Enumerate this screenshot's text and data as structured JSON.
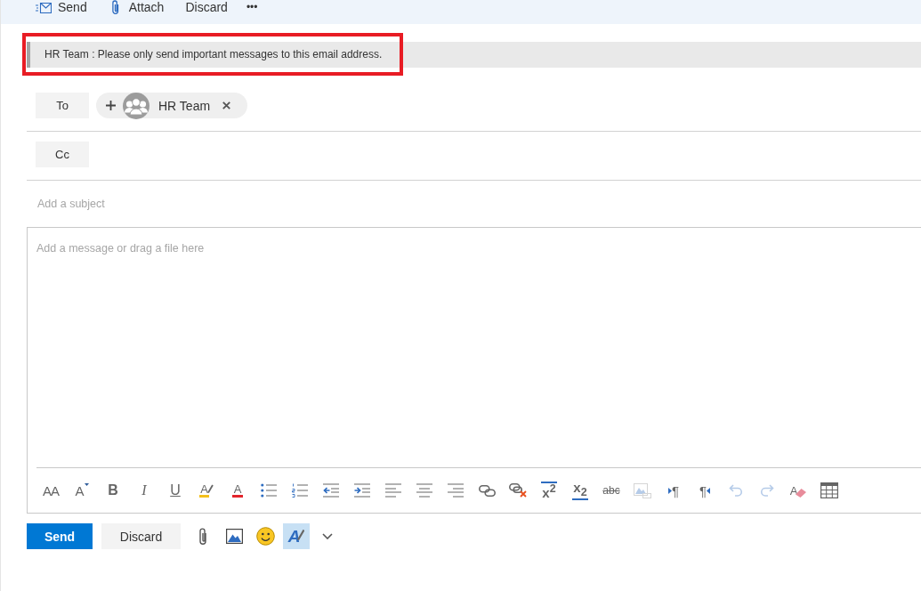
{
  "command_bar": [
    {
      "kind": "send",
      "label": "Send"
    },
    {
      "kind": "attach",
      "label": "Attach"
    },
    {
      "kind": "discard",
      "label": "Discard"
    },
    {
      "kind": "more",
      "label": "•••"
    }
  ],
  "mail_tip": {
    "text": "HR Team : Please only send important messages to this email address.",
    "highlighted": true
  },
  "recipients": [
    {
      "button": "To",
      "chips": [
        {
          "name": "HR Team"
        }
      ]
    },
    {
      "button": "Cc"
    }
  ],
  "subject": {
    "placeholder": "Add a subject"
  },
  "body": {
    "placeholder": "Add a message or drag a file here"
  },
  "format_toolbar": [
    {
      "kind": "font-size",
      "label": "AA",
      "disabled": false
    },
    {
      "kind": "grow-font",
      "label": "A",
      "disabled": false
    },
    {
      "kind": "bold",
      "label": "B",
      "disabled": false
    },
    {
      "kind": "italic",
      "label": "I",
      "disabled": false
    },
    {
      "kind": "underline",
      "label": "U",
      "disabled": false
    },
    {
      "kind": "highlight",
      "label": "A",
      "disabled": false
    },
    {
      "kind": "font-color",
      "label": "A",
      "disabled": false
    },
    {
      "kind": "bullets",
      "disabled": false
    },
    {
      "kind": "numbering",
      "disabled": false
    },
    {
      "kind": "outdent",
      "disabled": false
    },
    {
      "kind": "indent",
      "disabled": false
    },
    {
      "kind": "align-left",
      "disabled": false
    },
    {
      "kind": "align-center",
      "disabled": false
    },
    {
      "kind": "align-right",
      "disabled": false
    },
    {
      "kind": "link",
      "disabled": false
    },
    {
      "kind": "unlink",
      "disabled": false
    },
    {
      "kind": "superscript",
      "label": "x$^{2}$",
      "disabled": false
    },
    {
      "kind": "subscript",
      "label": "x$_{2}$",
      "disabled": false
    },
    {
      "kind": "strikethrough",
      "label": "abc",
      "disabled": false
    },
    {
      "kind": "image",
      "disabled": true
    },
    {
      "kind": "ltr",
      "label": "¶",
      "disabled": false
    },
    {
      "kind": "rtl",
      "label": "¶",
      "disabled": false
    },
    {
      "kind": "undo",
      "disabled": true
    },
    {
      "kind": "redo",
      "disabled": true
    },
    {
      "kind": "clear-format",
      "label": "A",
      "disabled": false
    },
    {
      "kind": "table",
      "disabled": false
    }
  ],
  "footer": {
    "send": "Send",
    "discard": "Discard",
    "tools": [
      {
        "kind": "attach",
        "active": false
      },
      {
        "kind": "image",
        "active": false
      },
      {
        "kind": "emoji",
        "active": false
      },
      {
        "kind": "format",
        "label": "A",
        "active": true
      },
      {
        "kind": "more",
        "active": false
      }
    ]
  }
}
